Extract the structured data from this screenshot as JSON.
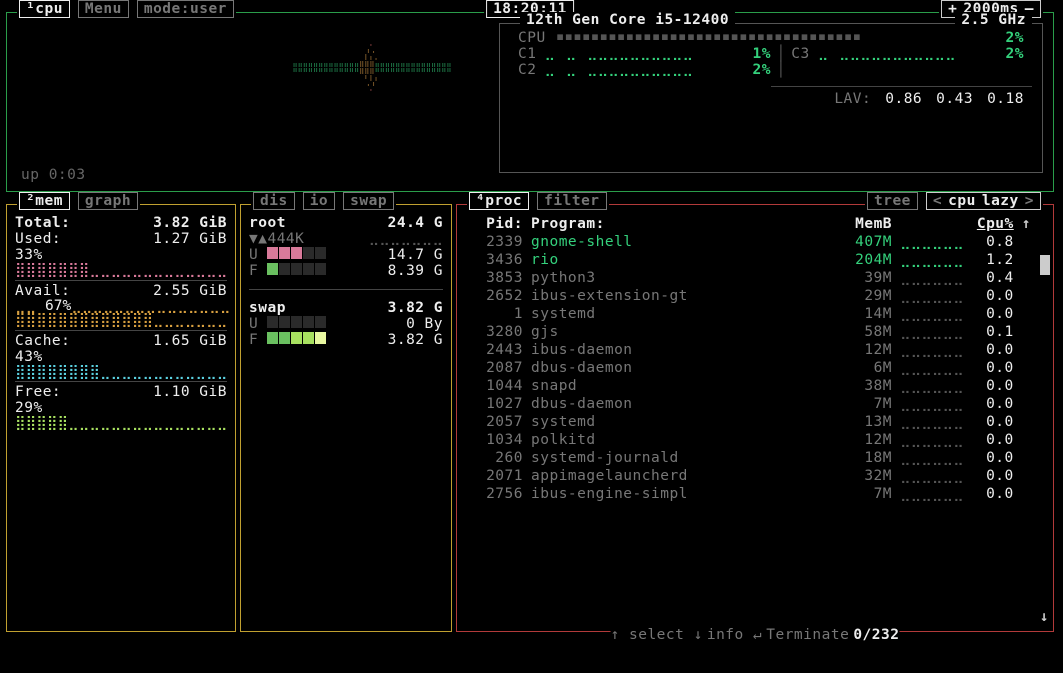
{
  "cpu_panel": {
    "tabs": {
      "id": "¹cpu",
      "menu": "Menu",
      "mode": "mode:user"
    },
    "clock": "18:20:11",
    "refresh": {
      "plus": "+",
      "value": "2000ms",
      "minus": "–"
    },
    "uptime": "up 0:03",
    "header": {
      "model": "12th Gen Core i5-12400",
      "freq": "2.5 GHz"
    },
    "overall": {
      "label": "CPU",
      "value": "2%"
    },
    "cores": [
      {
        "label": "C1",
        "value": "1%"
      },
      {
        "label": "C2",
        "value": "2%"
      },
      {
        "label": "C3",
        "value": "2%"
      }
    ],
    "lav": {
      "label": "LAV:",
      "v1": "0.86",
      "v2": "0.43",
      "v3": "0.18"
    }
  },
  "mem_panel": {
    "tabs": {
      "id": "²mem",
      "graph": "graph"
    },
    "total": {
      "label": "Total:",
      "value": "3.82 GiB"
    },
    "used": {
      "label": "Used:",
      "value": "1.27 GiB",
      "pct": "33%"
    },
    "avail": {
      "label": "Avail:",
      "value": "2.55 GiB",
      "pct": "67%"
    },
    "cache": {
      "label": "Cache:",
      "value": "1.65 GiB",
      "pct": "43%"
    },
    "free": {
      "label": "Free:",
      "value": "1.10 GiB",
      "pct": "29%"
    }
  },
  "disk_panel": {
    "tabs": {
      "dis": "dis",
      "io": "io",
      "swap": "swap"
    },
    "root": {
      "label": "root",
      "size": "24.4 G",
      "rate": "▼▲444K",
      "used_label": "U",
      "used": "14.7 G",
      "free_label": "F",
      "free": "8.39 G"
    },
    "swap": {
      "label": "swap",
      "size": "3.82 G",
      "used_label": "U",
      "used": "0 By",
      "free_label": "F",
      "free": "3.82 G"
    }
  },
  "proc_panel": {
    "tabs_left": {
      "id": "⁴proc",
      "filter": "filter"
    },
    "tabs_right": {
      "tree": "tree",
      "l": "<",
      "sort1": "cpu",
      "sort2": "lazy",
      "r": ">"
    },
    "headers": {
      "pid": "Pid:",
      "program": "Program:",
      "mem": "MemB",
      "cpu": "Cpu%"
    },
    "rows": [
      {
        "pid": "2339",
        "name": "gnome-shell",
        "mem": "407M",
        "cpu": "0.8",
        "hi": true
      },
      {
        "pid": "3436",
        "name": "rio",
        "mem": "204M",
        "cpu": "1.2",
        "hi": true
      },
      {
        "pid": "3853",
        "name": "python3",
        "mem": "39M",
        "cpu": "0.4"
      },
      {
        "pid": "2652",
        "name": "ibus-extension-gt",
        "mem": "29M",
        "cpu": "0.0"
      },
      {
        "pid": "1",
        "name": "systemd",
        "mem": "14M",
        "cpu": "0.0"
      },
      {
        "pid": "3280",
        "name": "gjs",
        "mem": "58M",
        "cpu": "0.1"
      },
      {
        "pid": "2443",
        "name": "ibus-daemon",
        "mem": "12M",
        "cpu": "0.0"
      },
      {
        "pid": "2087",
        "name": "dbus-daemon",
        "mem": "6M",
        "cpu": "0.0"
      },
      {
        "pid": "1044",
        "name": "snapd",
        "mem": "38M",
        "cpu": "0.0"
      },
      {
        "pid": "1027",
        "name": "dbus-daemon",
        "mem": "7M",
        "cpu": "0.0"
      },
      {
        "pid": "2057",
        "name": "systemd",
        "mem": "13M",
        "cpu": "0.0"
      },
      {
        "pid": "1034",
        "name": "polkitd",
        "mem": "12M",
        "cpu": "0.0"
      },
      {
        "pid": "260",
        "name": "systemd-journald",
        "mem": "18M",
        "cpu": "0.0"
      },
      {
        "pid": "2071",
        "name": "appimagelauncherd",
        "mem": "32M",
        "cpu": "0.0"
      },
      {
        "pid": "2756",
        "name": "ibus-engine-simpl",
        "mem": "7M",
        "cpu": "0.0"
      }
    ],
    "footer": {
      "select": "select",
      "info": "info",
      "terminate": "Terminate",
      "count": "0/232"
    },
    "arrows": {
      "up": "↑",
      "down": "↓",
      "enter": "↵"
    }
  }
}
